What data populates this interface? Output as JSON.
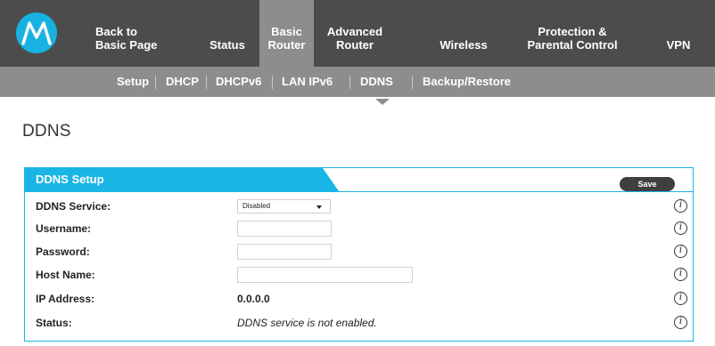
{
  "colors": {
    "topnav_bg": "#4c4c4c",
    "subnav_bg": "#8d8d8d",
    "accent": "#19b5e5",
    "save_button_bg": "#3f3f3f"
  },
  "logo": {
    "icon": "motorola-logo-icon"
  },
  "topnav": {
    "items": [
      {
        "label": "Back to\nBasic Page"
      },
      {
        "label": "Status"
      },
      {
        "label": "Basic\nRouter",
        "active": true
      },
      {
        "label": "Advanced\nRouter"
      },
      {
        "label": "Wireless"
      },
      {
        "label": "Protection &\nParental Control"
      },
      {
        "label": "VPN"
      }
    ]
  },
  "subnav": {
    "items": [
      {
        "label": "Setup"
      },
      {
        "label": "DHCP"
      },
      {
        "label": "DHCPv6"
      },
      {
        "label": "LAN IPv6"
      },
      {
        "label": "DDNS",
        "active": true
      },
      {
        "label": "Backup/Restore"
      }
    ]
  },
  "page": {
    "title": "DDNS"
  },
  "panel": {
    "title": "DDNS Setup",
    "save_label": "Save",
    "info_glyph": "i",
    "rows": {
      "service": {
        "label": "DDNS Service:",
        "value": "Disabled"
      },
      "username": {
        "label": "Username:",
        "value": ""
      },
      "password": {
        "label": "Password:",
        "value": ""
      },
      "hostname": {
        "label": "Host Name:",
        "value": ""
      },
      "ip": {
        "label": "IP Address:",
        "value": "0.0.0.0"
      },
      "status": {
        "label": "Status:",
        "value": "DDNS service is not enabled."
      }
    }
  }
}
